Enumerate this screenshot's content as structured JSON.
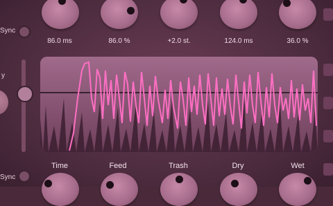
{
  "top_values": [
    "86.0 ms",
    "86.0 %",
    "+2.0 st.",
    "124.0 ms",
    "36.0 %"
  ],
  "bottom_labels": [
    "Time",
    "Feed",
    "Trash",
    "Dry",
    "Wet"
  ],
  "side": {
    "sync_top": "Sync",
    "sync_bottom": "Sync",
    "mid_fragment": "y"
  },
  "colors": {
    "accent": "#ff6fc4",
    "knob": "#a56b8a",
    "background": "#4f2d40"
  }
}
